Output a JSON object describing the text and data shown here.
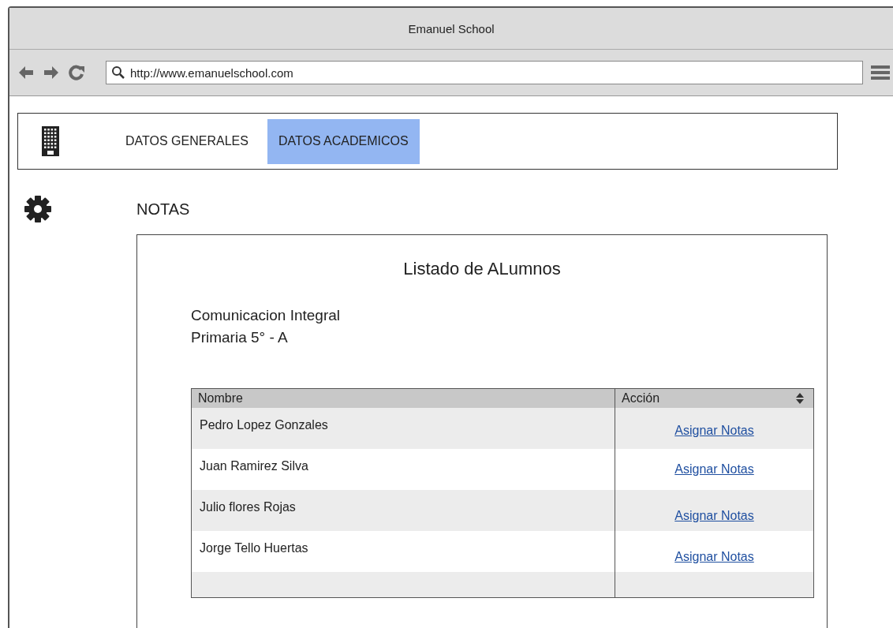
{
  "window": {
    "title": "Emanuel School"
  },
  "browser": {
    "url": "http://www.emanuelschool.com"
  },
  "nav_tabs": [
    {
      "label": "DATOS GENERALES",
      "selected": false
    },
    {
      "label": "DATOS ACADEMICOS",
      "selected": true
    }
  ],
  "section_title": "NOTAS",
  "panel": {
    "title": "Listado de ALumnos",
    "course": "Comunicacion Integral",
    "grade": "Primaria 5° - A",
    "table": {
      "columns": [
        "Nombre",
        "Acción"
      ],
      "rows": [
        {
          "name": "Pedro Lopez Gonzales",
          "action": "Asignar Notas"
        },
        {
          "name": "Juan Ramirez Silva",
          "action": "Asignar Notas"
        },
        {
          "name": "Julio flores Rojas",
          "action": "Asignar Notas"
        },
        {
          "name": "Jorge Tello Huertas",
          "action": "Asignar Notas"
        }
      ]
    }
  }
}
